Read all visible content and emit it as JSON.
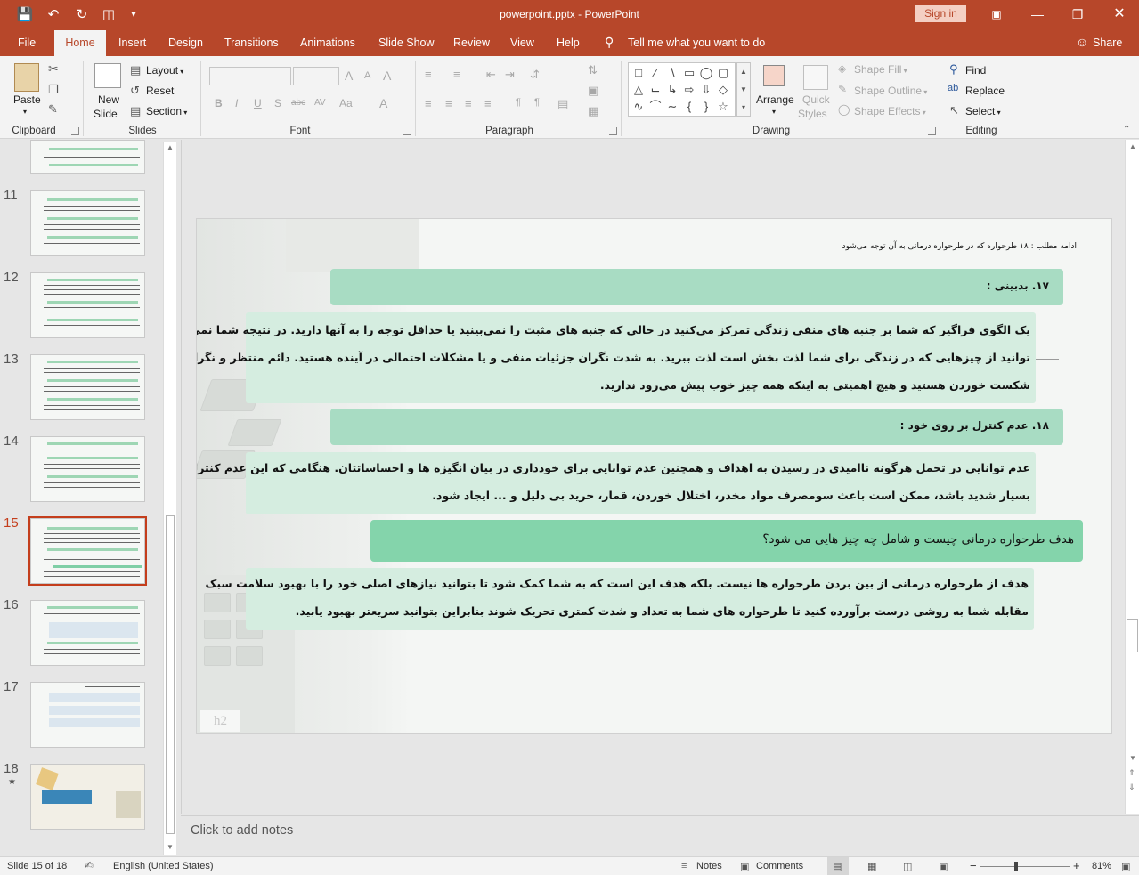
{
  "title_bar": {
    "document_title": "powerpoint.pptx - PowerPoint",
    "sign_in": "Sign in",
    "qa_icons": [
      "save-icon",
      "undo-icon",
      "redo-icon",
      "present-icon",
      "customize-icon"
    ]
  },
  "tabs": [
    "File",
    "Home",
    "Insert",
    "Design",
    "Transitions",
    "Animations",
    "Slide Show",
    "Review",
    "View",
    "Help"
  ],
  "active_tab": "Home",
  "tell_me": "Tell me what you want to do",
  "share": "Share",
  "ribbon": {
    "clipboard": {
      "label": "Clipboard",
      "paste": "Paste"
    },
    "slides": {
      "label": "Slides",
      "new_slide_1": "New",
      "new_slide_2": "Slide",
      "layout": "Layout",
      "reset": "Reset",
      "section": "Section"
    },
    "font": {
      "label": "Font",
      "bold": "B",
      "italic": "I",
      "underline": "U",
      "shadow": "S",
      "strike": "abc",
      "spacing": "AV",
      "case": "Aa",
      "grow": "A",
      "shrink": "A",
      "color": "A"
    },
    "paragraph": {
      "label": "Paragraph"
    },
    "drawing": {
      "label": "Drawing",
      "arrange": "Arrange",
      "quick_styles_1": "Quick",
      "quick_styles_2": "Styles",
      "shape_fill": "Shape Fill",
      "shape_outline": "Shape Outline",
      "shape_effects": "Shape Effects"
    },
    "editing": {
      "label": "Editing",
      "find": "Find",
      "replace": "Replace",
      "select": "Select"
    }
  },
  "slides_panel": {
    "numbers": [
      "11",
      "12",
      "13",
      "14",
      "15",
      "16",
      "17",
      "18"
    ],
    "selected": "15"
  },
  "slide": {
    "header": "ادامه مطلب : ۱۸ طرحواره که در طرحواره درمانی به آن توجه می‌شود",
    "h17": "۱۷. بدبینی :",
    "p17": [
      "یک الگوی فراگیر که شما بر جنبه های منفی زندگی تمرکز می‌کنید در حالی که جنبه های مثبت را نمی‌بینید یا حداقل توجه را به آنها دارید. در نتیجه شما نمی",
      "توانید از چیزهایی که در زندگی برای شما لذت بخش است لذت ببرید. به شدت نگران جزئیات منفی و یا مشکلات احتمالی در آینده هستید. دائم منتظر و نگران",
      "شکست خوردن هستید و هیچ اهمیتی به اینکه همه چیز خوب پیش می‌رود ندارید."
    ],
    "h18": "۱۸. عدم کنترل بر روی خود :",
    "p18": [
      "عدم توانایی در تحمل هرگونه ناامیدی در رسیدن به اهداف و همچنین عدم توانایی برای خودداری در بیان انگیزه ها و احساساتتان. هنگامی که این عدم کنترل",
      "بسیار شدید باشد، ممکن است باعث سومصرف مواد مخدر، اختلال خوردن، قمار، خرید بی دلیل و ... ایجاد شود."
    ],
    "hgoal": "هدف طرحواره درمانی چیست و شامل چه چیز هایی می شود؟",
    "pgoal": [
      "هدف از طرحواره درمانی از بین بردن طرحواره ها نیست. بلکه هدف این است که به شما کمک شود تا بتوانید نیازهای اصلی خود را با بهبود سلامت سبک",
      "مقابله شما به روشی درست برآورده کنید تا طرحواره های شما به تعداد و شدت کمتری تحریک شوند بنابراین بتوانید سریعتر بهبود یابید."
    ],
    "footer_tag": "h2"
  },
  "notes_placeholder": "Click to add notes",
  "status": {
    "slide_of": "Slide 15 of 18",
    "language": "English (United States)",
    "notes": "Notes",
    "comments": "Comments",
    "zoom": "81%",
    "zoom_minus": "−",
    "zoom_plus": "+"
  }
}
